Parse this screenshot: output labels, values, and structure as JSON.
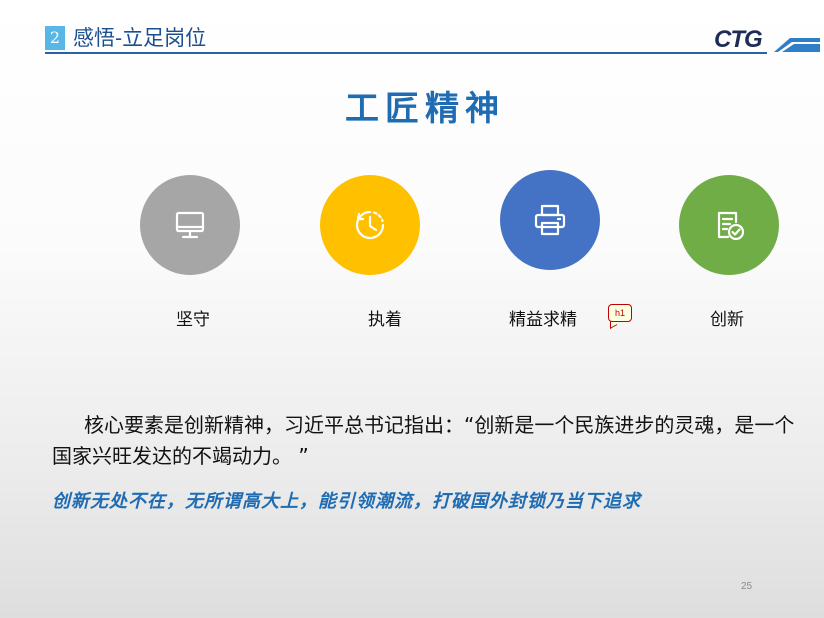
{
  "header": {
    "section_number": "2",
    "section_title": "感悟-立足岗位",
    "logo_text": "CTG"
  },
  "main": {
    "title": "工匠精神",
    "items": [
      {
        "label": "坚守",
        "icon": "monitor-icon",
        "color": "#a6a6a6"
      },
      {
        "label": "执着",
        "icon": "clock-icon",
        "color": "#ffc000"
      },
      {
        "label": "精益求精",
        "icon": "printer-icon",
        "color": "#4472c4"
      },
      {
        "label": "创新",
        "icon": "document-check-icon",
        "color": "#70ad47"
      }
    ],
    "comment_badge": "h1",
    "quote": "核心要素是创新精神，习近平总书记指出：“创新是一个民族进步的灵魂，是一个国家兴旺发达的不竭动力。 ”",
    "slogan": "创新无处不在，无所谓高大上，能引领潮流，打破国外封锁乃当下追求"
  },
  "footer": {
    "page_number": "25"
  }
}
